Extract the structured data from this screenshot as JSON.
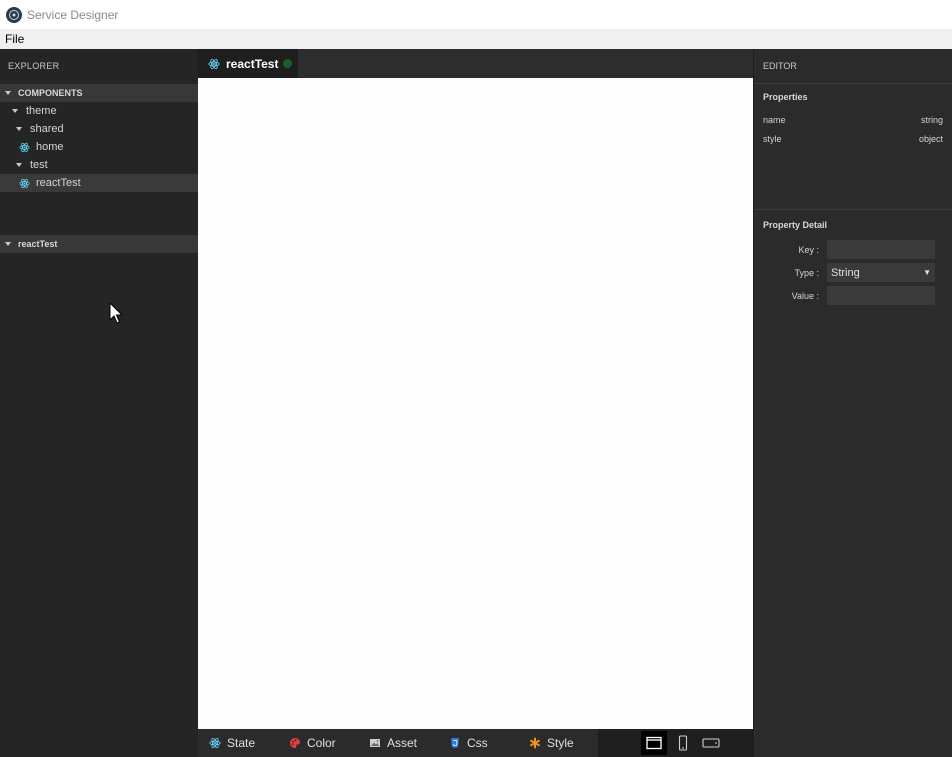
{
  "window": {
    "title": "Service Designer"
  },
  "menu": {
    "file": "File"
  },
  "explorer": {
    "title": "EXPLORER",
    "components_header": "COMPONENTS",
    "tree": [
      {
        "label": "theme",
        "depth": 0,
        "kind": "folder"
      },
      {
        "label": "shared",
        "depth": 1,
        "kind": "folder"
      },
      {
        "label": "home",
        "depth": 2,
        "kind": "component"
      },
      {
        "label": "test",
        "depth": 1,
        "kind": "folder"
      },
      {
        "label": "reactTest",
        "depth": 2,
        "kind": "component",
        "selected": true
      }
    ],
    "outline_header": "reactTest"
  },
  "tabs": [
    {
      "label": "reactTest",
      "active": true,
      "status_color": "#1f5e2b"
    }
  ],
  "bottom_toolbar": {
    "items": [
      {
        "label": "State",
        "icon": "react-icon"
      },
      {
        "label": "Color",
        "icon": "palette-icon"
      },
      {
        "label": "Asset",
        "icon": "image-icon"
      },
      {
        "label": "Css",
        "icon": "css-icon"
      },
      {
        "label": "Style",
        "icon": "asterisk-icon"
      }
    ],
    "devices": [
      {
        "name": "desktop-view",
        "active": true
      },
      {
        "name": "mobile-view",
        "active": false
      },
      {
        "name": "tablet-landscape-view",
        "active": false
      }
    ]
  },
  "editor": {
    "title": "EDITOR",
    "properties_title": "Properties",
    "properties": [
      {
        "name": "name",
        "type": "string"
      },
      {
        "name": "style",
        "type": "object"
      }
    ],
    "detail_title": "Property Detail",
    "key_label": "Key :",
    "type_label": "Type :",
    "type_value": "String",
    "value_label": "Value :",
    "key_value": "",
    "value_value": ""
  },
  "colors": {
    "react_icon": "#61dafb",
    "palette_icon": "#e04040",
    "css_icon": "#2a7bd6",
    "asterisk_icon": "#f09020"
  }
}
